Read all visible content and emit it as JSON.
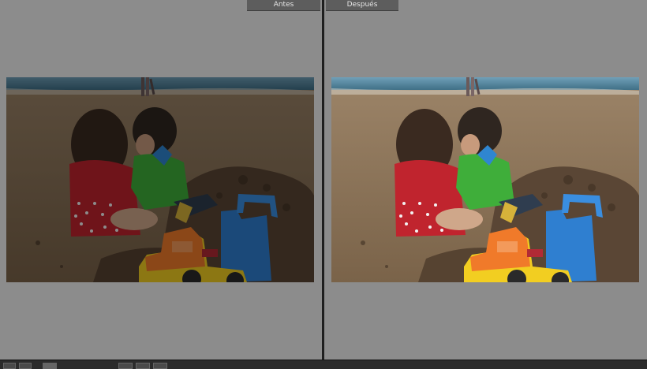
{
  "views": {
    "before_label": "Antes",
    "after_label": "Después"
  },
  "photo": {
    "subject": "children-playing-with-sand-toys-on-beach",
    "before_tone": "dark",
    "after_tone": "brightened"
  },
  "toolbar": {
    "visible_text_partial": ""
  },
  "colors": {
    "panel_bg": "#8c8c8c",
    "tab_bg": "#5d5d5d",
    "divider": "#1f1f1f",
    "toolbar_bg": "#2b2b2b"
  }
}
